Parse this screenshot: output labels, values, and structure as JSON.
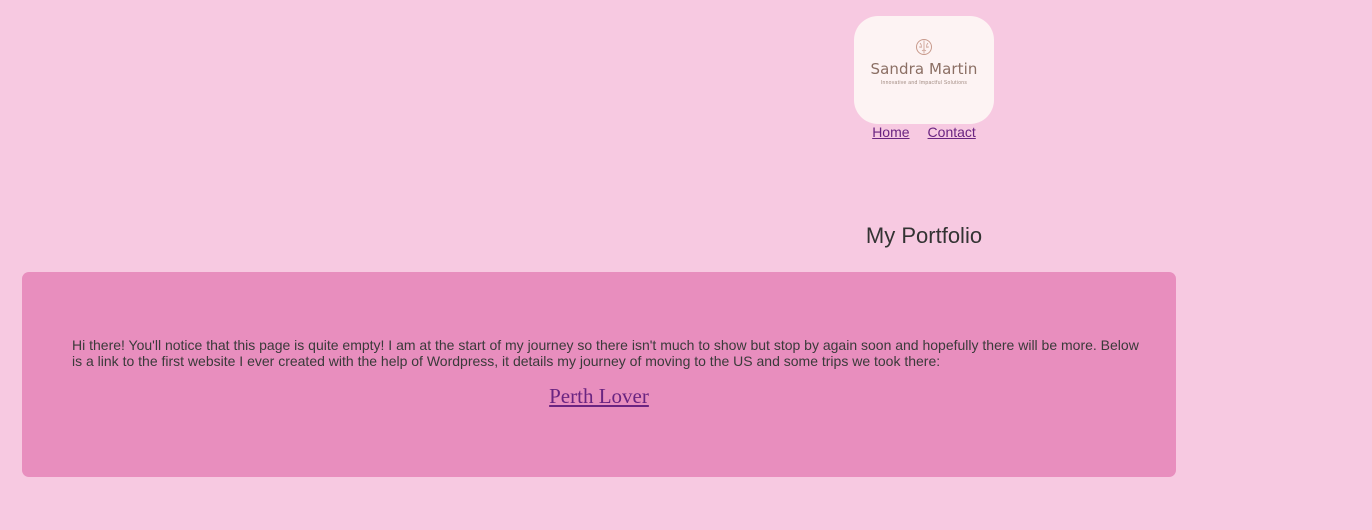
{
  "logo": {
    "icon": "brain-icon",
    "name": "Sandra Martin",
    "tagline": "Innovative and Impactful Solutions"
  },
  "nav": {
    "items": [
      {
        "label": "Home"
      },
      {
        "label": "Contact"
      }
    ]
  },
  "main": {
    "title": "My Portfolio",
    "intro": "Hi there! You'll notice that this page is quite empty! I am at the start of my journey so there isn't much to show but stop by again soon and hopefully there will be more. Below is a link to the first website I ever created with the help of Wordpress, it details my journey of moving to the US and some trips we took there:",
    "project_link": "Perth Lover"
  },
  "colors": {
    "page_background": "#f7c9e1",
    "panel_background": "#e88ebe",
    "logo_card": "#fdf3f3",
    "link": "#6a2481",
    "text": "#333333"
  }
}
